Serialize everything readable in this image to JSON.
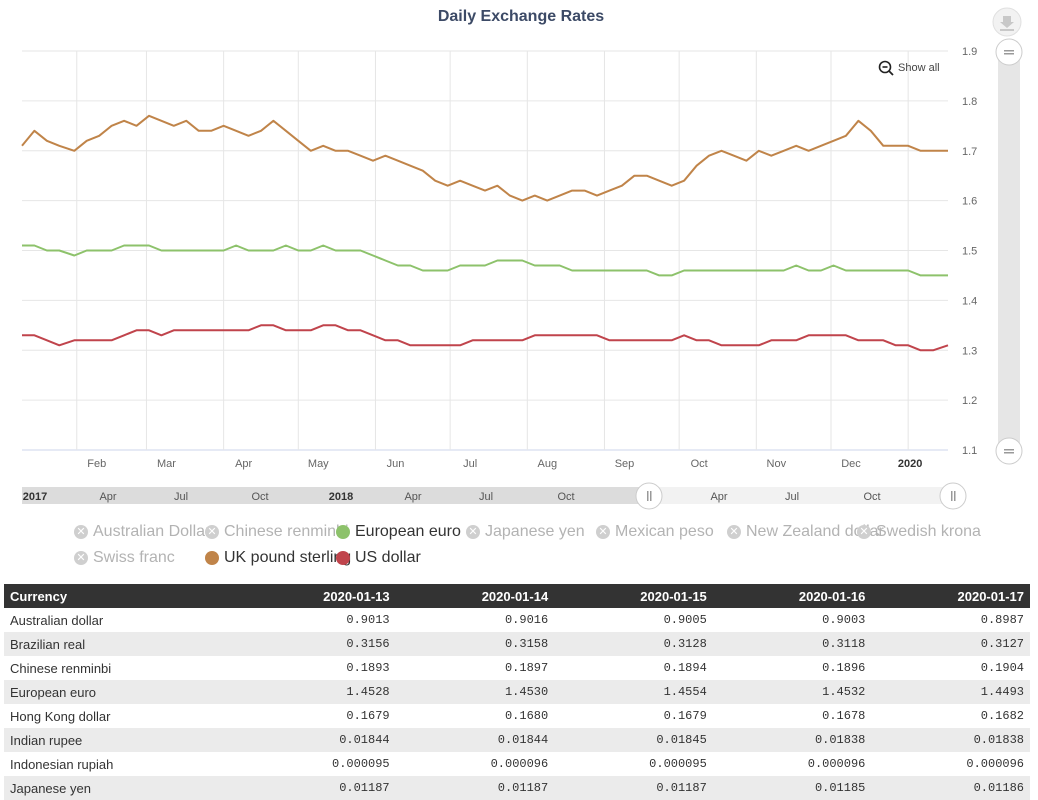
{
  "colors": {
    "gbp": "#c08449",
    "eur": "#8dc26b",
    "usd": "#c0444c",
    "grid": "#e6e6e6",
    "table_header_bg": "#333333"
  },
  "icons": {
    "download": "download-icon",
    "zoom_out": "zoom-out-icon",
    "legend_off": "x-circle-icon"
  },
  "show_all_label": "Show all",
  "navigator": {
    "labels": [
      "2017",
      "Apr",
      "Jul",
      "Oct",
      "2018",
      "Apr",
      "Jul",
      "Oct",
      "Apr",
      "Jul",
      "Oct"
    ],
    "bold": [
      "2017",
      "2018"
    ]
  },
  "legend": [
    {
      "label": "Australian Dollar",
      "active": false
    },
    {
      "label": "Chinese renminbi",
      "active": false
    },
    {
      "label": "European euro",
      "active": true,
      "color": "#8dc26b"
    },
    {
      "label": "Japanese yen",
      "active": false
    },
    {
      "label": "Mexican peso",
      "active": false
    },
    {
      "label": "New Zealand dollar",
      "active": false
    },
    {
      "label": "Swedish krona",
      "active": false
    },
    {
      "label": "Swiss franc",
      "active": false
    },
    {
      "label": "UK pound sterling",
      "active": true,
      "color": "#c08449"
    },
    {
      "label": "US dollar",
      "active": true,
      "color": "#c0444c"
    }
  ],
  "table": {
    "headers": [
      "Currency",
      "2020-01-13",
      "2020-01-14",
      "2020-01-15",
      "2020-01-16",
      "2020-01-17"
    ],
    "rows": [
      [
        "Australian dollar",
        "0.9013",
        "0.9016",
        "0.9005",
        "0.9003",
        "0.8987"
      ],
      [
        "Brazilian real",
        "0.3156",
        "0.3158",
        "0.3128",
        "0.3118",
        "0.3127"
      ],
      [
        "Chinese renminbi",
        "0.1893",
        "0.1897",
        "0.1894",
        "0.1896",
        "0.1904"
      ],
      [
        "European euro",
        "1.4528",
        "1.4530",
        "1.4554",
        "1.4532",
        "1.4493"
      ],
      [
        "Hong Kong dollar",
        "0.1679",
        "0.1680",
        "0.1679",
        "0.1678",
        "0.1682"
      ],
      [
        "Indian rupee",
        "0.01844",
        "0.01844",
        "0.01845",
        "0.01838",
        "0.01838"
      ],
      [
        "Indonesian rupiah",
        "0.000095",
        "0.000096",
        "0.000095",
        "0.000096",
        "0.000096"
      ],
      [
        "Japanese yen",
        "0.01187",
        "0.01187",
        "0.01187",
        "0.01185",
        "0.01186"
      ]
    ]
  },
  "chart_data": {
    "type": "line",
    "title": "Daily Exchange Rates",
    "x_ticks": [
      "Feb",
      "Mar",
      "Apr",
      "May",
      "Jun",
      "Jul",
      "Aug",
      "Sep",
      "Oct",
      "Nov",
      "Dec",
      "2020"
    ],
    "y_ticks": [
      1.1,
      1.2,
      1.3,
      1.4,
      1.5,
      1.6,
      1.7,
      1.8,
      1.9
    ],
    "ylim": [
      1.1,
      1.9
    ],
    "xlim": [
      "2019-01-10",
      "2020-01-17"
    ],
    "grid": true,
    "y_axis_side": "right",
    "x": [
      "2019-01-10",
      "2019-01-15",
      "2019-01-20",
      "2019-01-25",
      "2019-01-31",
      "2019-02-05",
      "2019-02-10",
      "2019-02-15",
      "2019-02-20",
      "2019-02-25",
      "2019-03-02",
      "2019-03-07",
      "2019-03-12",
      "2019-03-17",
      "2019-03-22",
      "2019-03-27",
      "2019-04-01",
      "2019-04-06",
      "2019-04-11",
      "2019-04-16",
      "2019-04-21",
      "2019-04-26",
      "2019-05-01",
      "2019-05-06",
      "2019-05-11",
      "2019-05-16",
      "2019-05-21",
      "2019-05-26",
      "2019-05-31",
      "2019-06-05",
      "2019-06-10",
      "2019-06-15",
      "2019-06-20",
      "2019-06-25",
      "2019-06-30",
      "2019-07-05",
      "2019-07-10",
      "2019-07-15",
      "2019-07-20",
      "2019-07-25",
      "2019-07-30",
      "2019-08-04",
      "2019-08-09",
      "2019-08-14",
      "2019-08-19",
      "2019-08-24",
      "2019-08-29",
      "2019-09-03",
      "2019-09-08",
      "2019-09-13",
      "2019-09-18",
      "2019-09-23",
      "2019-09-28",
      "2019-10-03",
      "2019-10-08",
      "2019-10-13",
      "2019-10-18",
      "2019-10-23",
      "2019-10-28",
      "2019-11-02",
      "2019-11-07",
      "2019-11-12",
      "2019-11-17",
      "2019-11-22",
      "2019-11-27",
      "2019-12-02",
      "2019-12-07",
      "2019-12-12",
      "2019-12-17",
      "2019-12-22",
      "2019-12-27",
      "2020-01-01",
      "2020-01-06",
      "2020-01-11",
      "2020-01-17"
    ],
    "series": [
      {
        "name": "UK pound sterling",
        "values": [
          1.71,
          1.74,
          1.72,
          1.71,
          1.7,
          1.72,
          1.73,
          1.75,
          1.76,
          1.75,
          1.77,
          1.76,
          1.75,
          1.76,
          1.74,
          1.74,
          1.75,
          1.74,
          1.73,
          1.74,
          1.76,
          1.74,
          1.72,
          1.7,
          1.71,
          1.7,
          1.7,
          1.69,
          1.68,
          1.69,
          1.68,
          1.67,
          1.66,
          1.64,
          1.63,
          1.64,
          1.63,
          1.62,
          1.63,
          1.61,
          1.6,
          1.61,
          1.6,
          1.61,
          1.62,
          1.62,
          1.61,
          1.62,
          1.63,
          1.65,
          1.65,
          1.64,
          1.63,
          1.64,
          1.67,
          1.69,
          1.7,
          1.69,
          1.68,
          1.7,
          1.69,
          1.7,
          1.71,
          1.7,
          1.71,
          1.72,
          1.73,
          1.76,
          1.74,
          1.71,
          1.71,
          1.71,
          1.7,
          1.7,
          1.7
        ]
      },
      {
        "name": "European euro",
        "values": [
          1.51,
          1.51,
          1.5,
          1.5,
          1.49,
          1.5,
          1.5,
          1.5,
          1.51,
          1.51,
          1.51,
          1.5,
          1.5,
          1.5,
          1.5,
          1.5,
          1.5,
          1.51,
          1.5,
          1.5,
          1.5,
          1.51,
          1.5,
          1.5,
          1.51,
          1.5,
          1.5,
          1.5,
          1.49,
          1.48,
          1.47,
          1.47,
          1.46,
          1.46,
          1.46,
          1.47,
          1.47,
          1.47,
          1.48,
          1.48,
          1.48,
          1.47,
          1.47,
          1.47,
          1.46,
          1.46,
          1.46,
          1.46,
          1.46,
          1.46,
          1.46,
          1.45,
          1.45,
          1.46,
          1.46,
          1.46,
          1.46,
          1.46,
          1.46,
          1.46,
          1.46,
          1.46,
          1.47,
          1.46,
          1.46,
          1.47,
          1.46,
          1.46,
          1.46,
          1.46,
          1.46,
          1.46,
          1.45,
          1.45,
          1.45
        ]
      },
      {
        "name": "US dollar",
        "values": [
          1.33,
          1.33,
          1.32,
          1.31,
          1.32,
          1.32,
          1.32,
          1.32,
          1.33,
          1.34,
          1.34,
          1.33,
          1.34,
          1.34,
          1.34,
          1.34,
          1.34,
          1.34,
          1.34,
          1.35,
          1.35,
          1.34,
          1.34,
          1.34,
          1.35,
          1.35,
          1.34,
          1.34,
          1.33,
          1.32,
          1.32,
          1.31,
          1.31,
          1.31,
          1.31,
          1.31,
          1.32,
          1.32,
          1.32,
          1.32,
          1.32,
          1.33,
          1.33,
          1.33,
          1.33,
          1.33,
          1.33,
          1.32,
          1.32,
          1.32,
          1.32,
          1.32,
          1.32,
          1.33,
          1.32,
          1.32,
          1.31,
          1.31,
          1.31,
          1.31,
          1.32,
          1.32,
          1.32,
          1.33,
          1.33,
          1.33,
          1.33,
          1.32,
          1.32,
          1.32,
          1.31,
          1.31,
          1.3,
          1.3,
          1.31
        ]
      }
    ]
  }
}
